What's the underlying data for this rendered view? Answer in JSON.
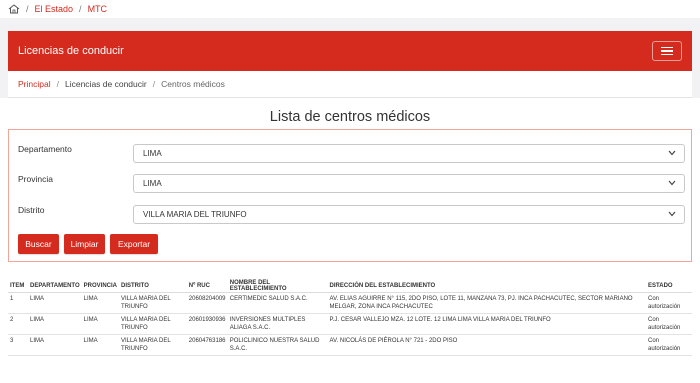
{
  "topbar": {
    "crumbs": [
      "El Estado",
      "MTC"
    ],
    "home_icon": "home-icon"
  },
  "header": {
    "title": "Licencias de conducir",
    "menu_icon": "hamburger-menu-icon",
    "color": "#d52b1e"
  },
  "breadcrumb": {
    "items": [
      "Principal",
      "Licencias de conducir",
      "Centros médicos"
    ]
  },
  "page": {
    "title": "Lista de centros médicos"
  },
  "filters": {
    "departamento": {
      "label": "Departamento",
      "value": "LIMA"
    },
    "provincia": {
      "label": "Provincia",
      "value": "LIMA"
    },
    "distrito": {
      "label": "Distrito",
      "value": "VILLA MARIA DEL TRIUNFO"
    }
  },
  "buttons": {
    "buscar": "Buscar",
    "limpiar": "Limpiar",
    "exportar": "Exportar"
  },
  "table": {
    "headers": [
      "ITEM",
      "DEPARTAMENTO",
      "PROVINCIA",
      "DISTRITO",
      "Nº RUC",
      "NOMBRE DEL ESTABLECIMIENTO",
      "DIRECCIÓN DEL ESTABLECIMIENTO",
      "ESTADO"
    ],
    "rows": [
      [
        "1",
        "LIMA",
        "LIMA",
        "VILLA MARIA DEL TRIUNFO",
        "20608204009",
        "CERTIMEDIC SALUD S.A.C.",
        "AV. ELIAS AGUIRRE N° 115, 2DO PISO, LOTE 11, MANZANA 73, PJ. INCA PACHACUTEC, SECTOR MARIANO MELGAR, ZONA INCA PACHACUTEC",
        "Con autorización"
      ],
      [
        "2",
        "LIMA",
        "LIMA",
        "VILLA MARIA DEL TRIUNFO",
        "20601930936",
        "INVERSIONES MULTIPLES ALIAGA S.A.C.",
        "P.J. CESAR VALLEJO MZA. 12 LOTE. 12 LIMA LIMA VILLA MARIA DEL TRIUNFO",
        "Con autorización"
      ],
      [
        "3",
        "LIMA",
        "LIMA",
        "VILLA MARIA DEL TRIUNFO",
        "20604763186",
        "POLICLINICO NUESTRA SALUD S.A.C.",
        "AV. NICOLÁS DE PIÉROLA N° 721 - 2DO PISO",
        "Con autorización"
      ]
    ]
  }
}
